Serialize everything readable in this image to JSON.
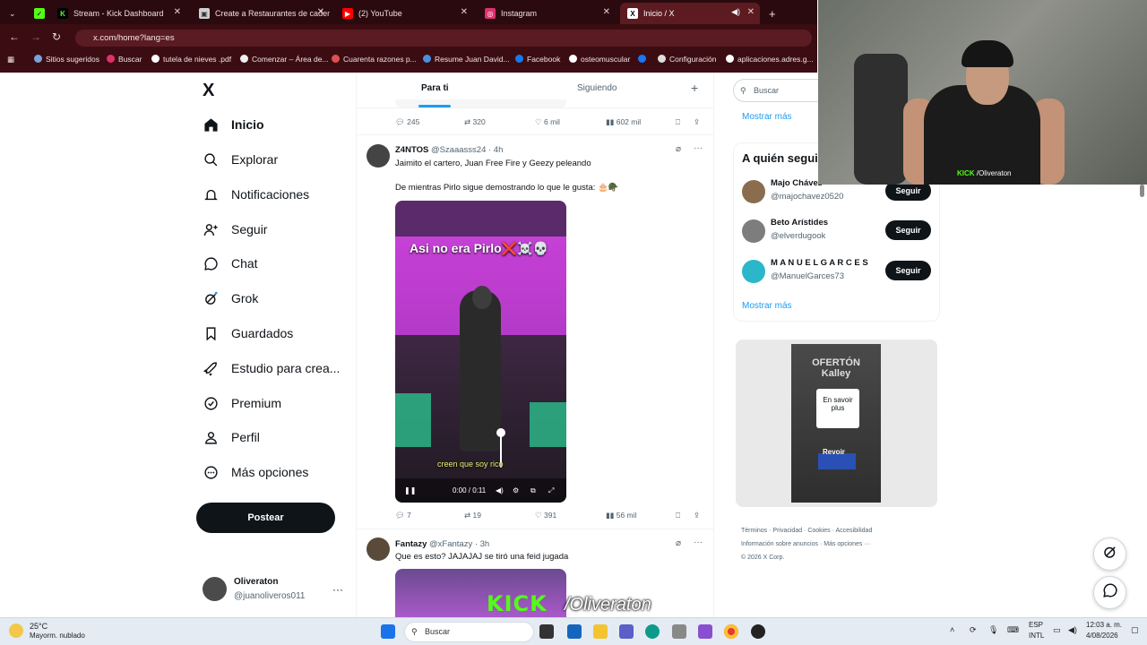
{
  "browser": {
    "tabs": [
      {
        "label": "Stream - Kick Dashboard",
        "fav": "K",
        "color": "#53fc18"
      },
      {
        "label": "Create a Restaurantes de caden",
        "fav": "▣",
        "color": "#d0d0d0"
      },
      {
        "label": "(2) YouTube",
        "fav": "▶",
        "color": "#ff0000"
      },
      {
        "label": "Instagram",
        "fav": "◎",
        "color": "#e1306c"
      },
      {
        "label": "Inicio / X",
        "fav": "X",
        "color": "#000000"
      }
    ],
    "url": "x.com/home?lang=es",
    "bookmarks": [
      "Sitios sugeridos",
      "Buscar",
      "tutela de nieves .pdf",
      "Comenzar – Área de...",
      "Cuarenta razones p...",
      "Resume Juan David...",
      "Facebook",
      "osteomuscular",
      "Configuración",
      "aplicaciones.adres.g..."
    ]
  },
  "nav": {
    "logo": "X",
    "items": [
      "Inicio",
      "Explorar",
      "Notificaciones",
      "Seguir",
      "Chat",
      "Grok",
      "Guardados",
      "Estudio para crea...",
      "Premium",
      "Perfil",
      "Más opciones"
    ],
    "post": "Postear",
    "user": {
      "name": "Oliveraton",
      "handle": "@juanoliveros011",
      "more": "···"
    }
  },
  "feed": {
    "tabs": {
      "for_you": "Para ti",
      "following": "Siguiendo",
      "plus": "+"
    },
    "top_actions": {
      "replies": "245",
      "reposts": "320",
      "likes": "6 mil",
      "views": "602 mil"
    },
    "tweet1": {
      "name": "Z4NTOS",
      "meta": "@Szaaasss24 · 4h",
      "line1": "Jaimito el cartero, Juan Free Fire y Geezy peleando",
      "line2": "De mientras Pirlo sigue demostrando lo que le gusta: 🎂🪖",
      "video_title": "Asi no era Pirlo❌☠️💀",
      "video_sub": "creen que soy rico",
      "video_time": "0:00 / 0:11",
      "actions": {
        "replies": "7",
        "reposts": "19",
        "likes": "391",
        "views": "56 mil"
      }
    },
    "tweet2": {
      "name": "Fantazy",
      "meta": "@xFantazy · 3h",
      "line1": "Que es esto? JAJAJAJ se tiró una feid jugada"
    },
    "watermark_kick": "KICK",
    "watermark_name": "/Oliveraton"
  },
  "right": {
    "search_placeholder": "Buscar",
    "show_more": "Mostrar más",
    "who_title": "A quién seguir",
    "who": [
      {
        "name": "Majo Chávez",
        "handle": "@majochavez0520",
        "btn": "Seguir",
        "color": "#8a6d4f"
      },
      {
        "name": "Beto Arístides",
        "handle": "@elverdugook",
        "btn": "Seguir",
        "color": "#7d7d7d"
      },
      {
        "name": "M A N U E L G A R C E S",
        "handle": "@ManuelGarces73",
        "btn": "Seguir",
        "color": "#2ab7c9"
      }
    ],
    "ad": {
      "title": "OFERTÓN Kalley",
      "cta": "En savoir plus",
      "review": "Revoir"
    },
    "footer_line1": [
      "Términos",
      "Privacidad",
      "Cookies",
      "Accesibilidad"
    ],
    "footer_line2": [
      "Información sobre anuncios",
      "Más opciones ···"
    ],
    "copyright": "© 2026 X Corp."
  },
  "webcam": {
    "kick": "KICK",
    "name": "/Oliveraton"
  },
  "taskbar": {
    "weather_temp": "25°C",
    "weather_desc": "Mayorm. nublado",
    "search": "Buscar",
    "lang1": "ESP",
    "lang2": "INTL",
    "time": "12:03 a. m.",
    "date": "4/08/2026"
  }
}
